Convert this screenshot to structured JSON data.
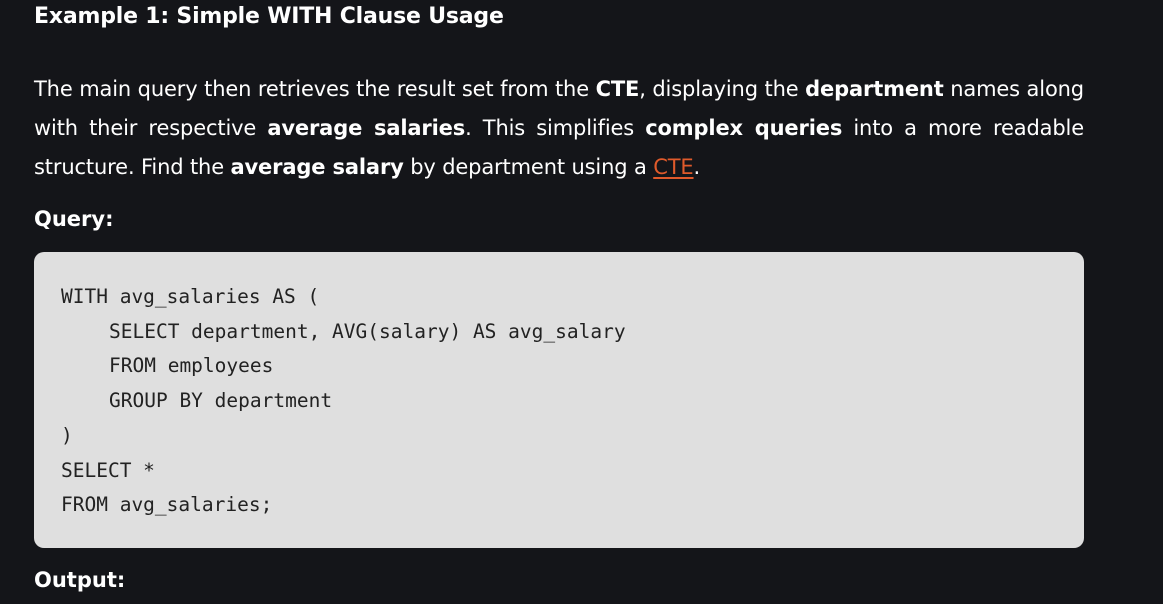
{
  "heading": "Example 1: Simple WITH Clause Usage",
  "paragraph": {
    "t1": "The main query then retrieves the result set from the ",
    "b1": "CTE",
    "t2": ", displaying the ",
    "b2": "department",
    "t3": " names along with their respective ",
    "b3": "average salaries",
    "t4": ". This simplifies ",
    "b4": "complex queries",
    "t5": " into a more readable structure. Find the ",
    "b5": "average salary",
    "t6": " by department using a ",
    "link": "CTE",
    "t7": "."
  },
  "query_label": "Query:",
  "code_lines": [
    "WITH avg_salaries AS (",
    "SELECT department, AVG(salary) AS avg_salary",
    "FROM employees",
    "GROUP BY department",
    ")",
    "SELECT *",
    "FROM avg_salaries;"
  ],
  "output_label": "Output:",
  "colors": {
    "background": "#141519",
    "code_background": "#dfdfdf",
    "link": "#e05a2b"
  }
}
